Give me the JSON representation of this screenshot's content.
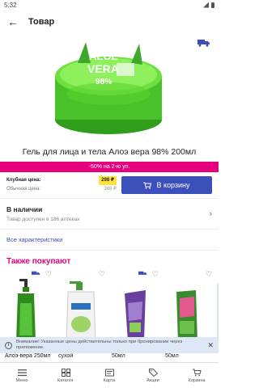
{
  "status_bar": {
    "time": "5:32"
  },
  "header": {
    "title": "Товар"
  },
  "product": {
    "image_text": {
      "line1": "ALOE",
      "line2": "VERA",
      "line3": "98%"
    },
    "title": "Гель для лица и тела Алоэ вера 98% 200мл",
    "promo": "-50% на 2-ю уп.",
    "club_price_label": "Клубная цена:",
    "regular_price_label": "Обычная цена:",
    "club_price": "298 ₽",
    "regular_price": "368 ₽",
    "cart_button": "В корзину"
  },
  "availability": {
    "title": "В наличии",
    "subtitle": "Товар доступен в 186 аптеках"
  },
  "all_specs": "Все характеристики",
  "also_buy": {
    "title": "Также покупают",
    "items": [
      {
        "name": "Алоэ-вера 250мл"
      },
      {
        "name": "сухой"
      },
      {
        "name": "50мл"
      },
      {
        "name": "50мл"
      }
    ]
  },
  "notice": {
    "text": "Внимание! Указанные цены действительны только при бронировании через приложение."
  },
  "bottom_nav": {
    "items": [
      {
        "label": "Меню"
      },
      {
        "label": "Каталог"
      },
      {
        "label": "Карта"
      },
      {
        "label": "Акции"
      },
      {
        "label": "Корзина"
      }
    ]
  },
  "colors": {
    "accent": "#3a4fb9",
    "promo": "#e6007e",
    "club_price_bg": "#ffe23d"
  }
}
